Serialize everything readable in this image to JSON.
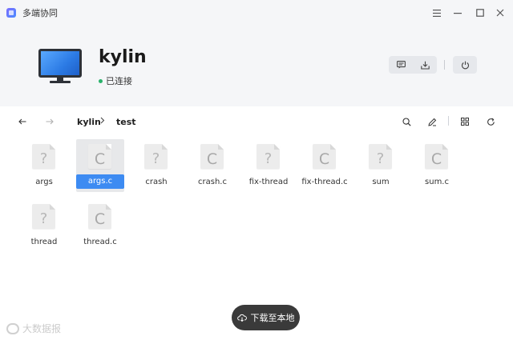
{
  "window": {
    "title": "多端协同",
    "controls": [
      "menu-icon",
      "minimize-icon",
      "maximize-icon",
      "close-icon"
    ]
  },
  "device": {
    "name": "kylin",
    "status_text": "已连接",
    "status_color": "#2ab26b",
    "actions_left": [
      "chat-icon",
      "download-tray-icon"
    ],
    "actions_right": [
      "power-icon"
    ]
  },
  "toolbar": {
    "breadcrumb": [
      "kylin",
      "test"
    ],
    "tools": [
      "search-icon",
      "edit-pen-icon",
      "grid-view-icon",
      "refresh-icon"
    ]
  },
  "files": [
    {
      "name": "args",
      "type": "unknown",
      "glyph": "?"
    },
    {
      "name": "args.c",
      "type": "c",
      "glyph": "C",
      "selected": true
    },
    {
      "name": "crash",
      "type": "unknown",
      "glyph": "?"
    },
    {
      "name": "crash.c",
      "type": "c",
      "glyph": "C"
    },
    {
      "name": "fix-thread",
      "type": "unknown",
      "glyph": "?"
    },
    {
      "name": "fix-thread.c",
      "type": "c",
      "glyph": "C"
    },
    {
      "name": "sum",
      "type": "unknown",
      "glyph": "?"
    },
    {
      "name": "sum.c",
      "type": "c",
      "glyph": "C"
    },
    {
      "name": "thread",
      "type": "unknown",
      "glyph": "?"
    },
    {
      "name": "thread.c",
      "type": "c",
      "glyph": "C"
    }
  ],
  "download_button": {
    "label": "下载至本地"
  },
  "watermark": {
    "text": "大数据报"
  },
  "colors": {
    "accent": "#3d8bf2",
    "header_bg": "#f5f6f8",
    "dark_button": "#3a3a3a"
  }
}
